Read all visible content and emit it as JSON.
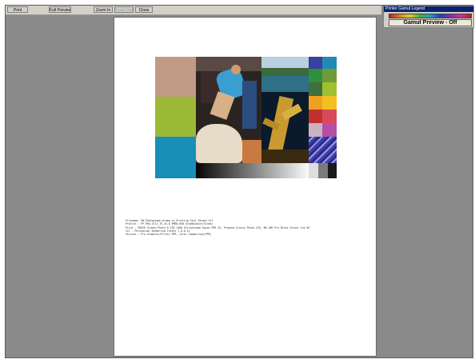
{
  "toolbar": {
    "buttons": [
      {
        "label": "Print",
        "enabled": true
      },
      {
        "label": "Full Preview",
        "enabled": true
      },
      {
        "label": "Zoom In",
        "enabled": true
      },
      {
        "label": "Zoom Out",
        "enabled": false
      },
      {
        "label": "Close",
        "enabled": true
      }
    ]
  },
  "legend": {
    "title": "Printer Gamut Legend",
    "status": "Gamut Preview - Off"
  },
  "test_chart": {
    "swatches_left": [
      "#c19a85",
      "#9ab934",
      "#178fb8"
    ],
    "swatches_right": [
      [
        "#3a3fa0",
        "#1f8ab5"
      ],
      [
        "#2f8f3f",
        "#6f9a3a"
      ],
      [
        "#3f6f3a",
        "#9fc030"
      ],
      [
        "#f0a020",
        "#f2c020"
      ],
      [
        "#c03030",
        "#d84a5a"
      ],
      [
        "#c9b3c0",
        "#b54fa6"
      ]
    ]
  },
  "metadata_lines": [
    "Filename: PW_Photograph_brama_vs_Printing_Test_Target.tif",
    "Profile  : PP_PRO_V111_TS_43.0 PMEN_RGB GrayBalance(Sinha)",
    "Print    : PRO2R Studio Photo R IFD 1400 Ultrachrome Epson PPR 43, Premium Glossy Photo 255, MK-10R Pro Black Colour Ink 8S",
    "ICC      : Perceptual Rendering Intent 1.0.0.12",
    "Version  : Pro Graphics/Prints PPR, Color Comparison(PPR)"
  ]
}
